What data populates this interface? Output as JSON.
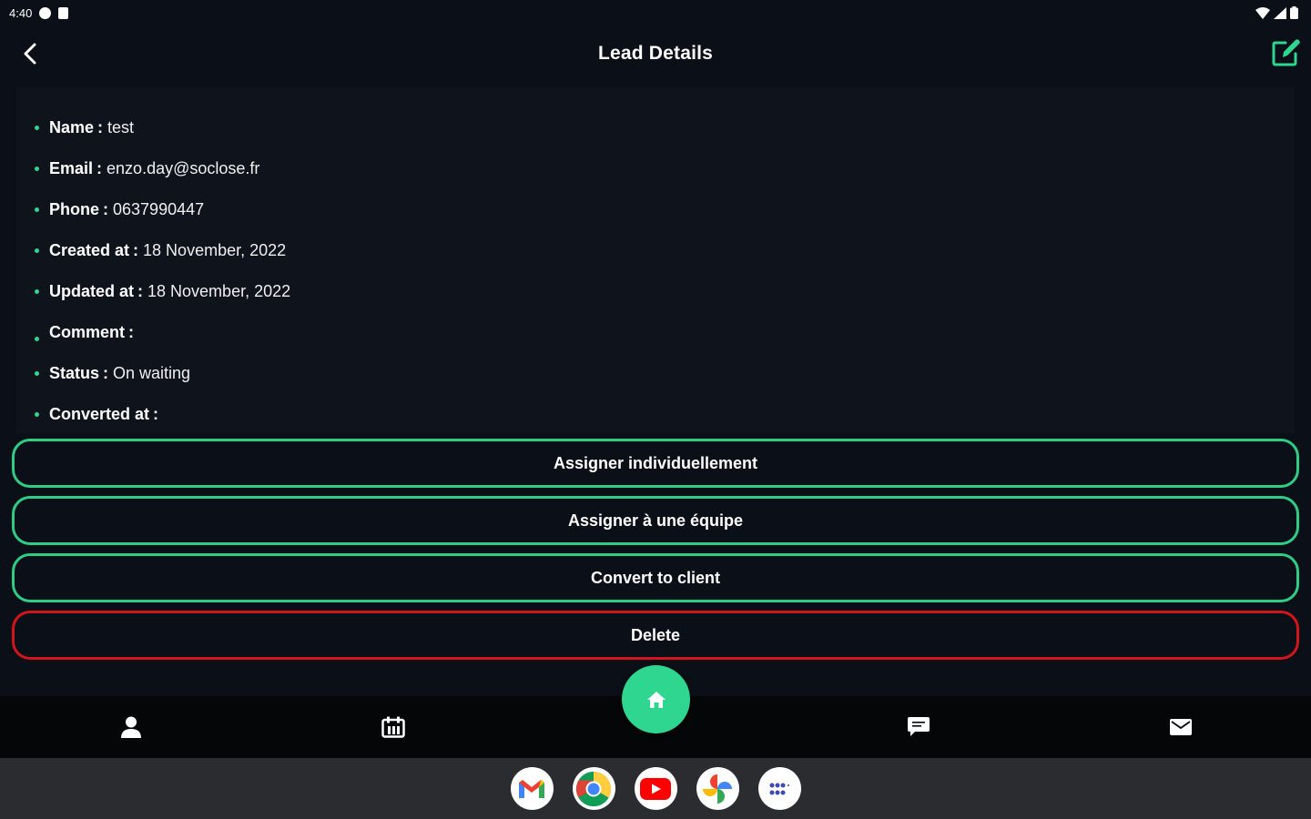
{
  "status_bar": {
    "time": "4:40",
    "icons": [
      "settings-icon",
      "sd-card-icon",
      "wifi-icon",
      "signal-icon",
      "battery-icon"
    ]
  },
  "header": {
    "title": "Lead Details",
    "back_icon": "chevron-left-icon",
    "edit_icon": "edit-icon"
  },
  "details": {
    "name": {
      "label": "Name",
      "value": "test"
    },
    "email": {
      "label": "Email",
      "value": "enzo.day@soclose.fr"
    },
    "phone": {
      "label": "Phone",
      "value": "0637990447"
    },
    "created_at": {
      "label": "Created at",
      "value": "18 November, 2022"
    },
    "updated_at": {
      "label": "Updated at",
      "value": "18 November, 2022"
    },
    "comment": {
      "label": "Comment",
      "value": ""
    },
    "status": {
      "label": "Status",
      "value": "On waiting"
    },
    "converted_at": {
      "label": "Converted at",
      "value": ""
    }
  },
  "separator": ":",
  "actions": {
    "assign_individual": "Assigner individuellement",
    "assign_team": "Assigner à une équipe",
    "convert": "Convert to client",
    "delete": "Delete"
  },
  "bottom_nav": {
    "items": [
      "person-icon",
      "calendar-icon",
      "home-icon",
      "chat-icon",
      "mail-icon"
    ]
  },
  "taskbar": {
    "apps": [
      "gmail-icon",
      "chrome-icon",
      "youtube-icon",
      "photos-icon",
      "app-drawer-icon"
    ]
  },
  "colors": {
    "background": "#0b0f17",
    "card": "#0e131c",
    "accent": "#2fd68f",
    "danger": "#d2151b",
    "nav_bar": "#050608",
    "taskbar": "#2b2c30"
  }
}
